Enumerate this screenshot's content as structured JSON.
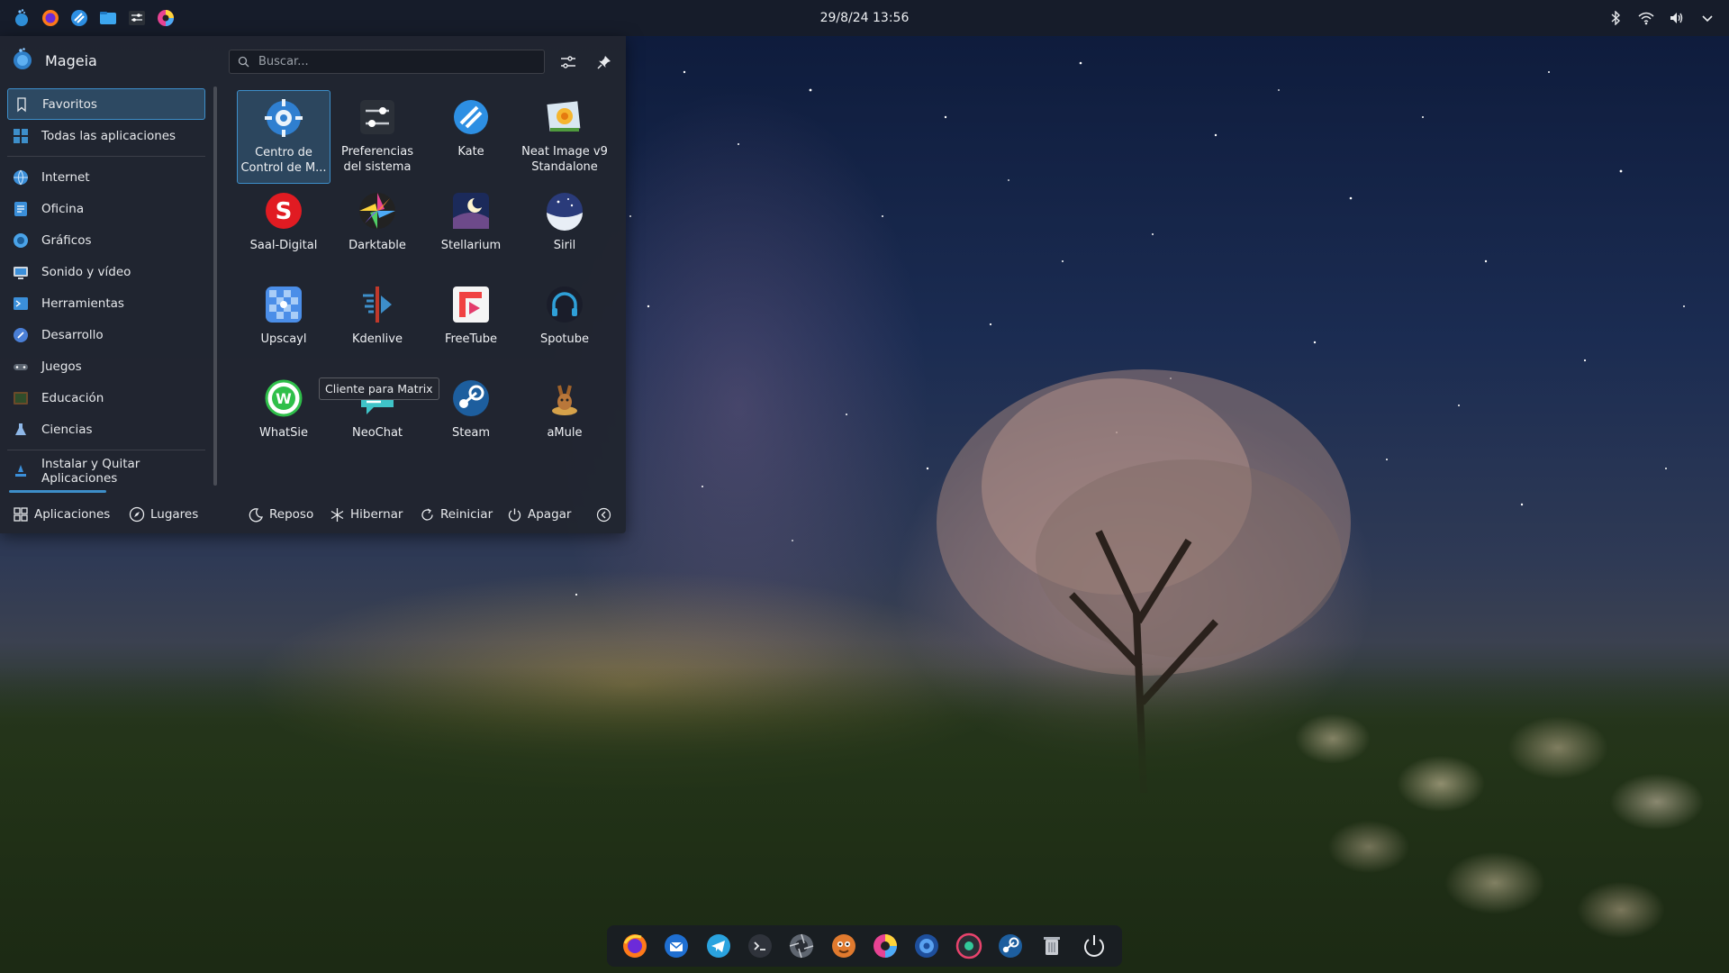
{
  "top_panel": {
    "clock": "29/8/24 13:56",
    "left_icons": [
      "mageia-menu-icon",
      "firefox-icon",
      "kate-icon",
      "file-manager-icon",
      "system-settings-icon",
      "color-wheel-icon"
    ],
    "tray_icons": [
      "bluetooth-icon",
      "wifi-icon",
      "volume-icon",
      "chevron-down-icon"
    ]
  },
  "launcher": {
    "user": "Mageia",
    "search": {
      "placeholder": "Buscar...",
      "value": ""
    },
    "categories": [
      {
        "label": "Favoritos",
        "icon": "bookmark-icon",
        "active": true
      },
      {
        "label": "Todas las aplicaciones",
        "icon": "grid-icon",
        "active": false
      },
      {
        "label": "Internet",
        "icon": "internet-icon",
        "active": false
      },
      {
        "label": "Oficina",
        "icon": "office-icon",
        "active": false
      },
      {
        "label": "Gráficos",
        "icon": "graphics-icon",
        "active": false
      },
      {
        "label": "Sonido y vídeo",
        "icon": "multimedia-icon",
        "active": false
      },
      {
        "label": "Herramientas",
        "icon": "tools-icon",
        "active": false
      },
      {
        "label": "Desarrollo",
        "icon": "development-icon",
        "active": false
      },
      {
        "label": "Juegos",
        "icon": "games-icon",
        "active": false
      },
      {
        "label": "Educación",
        "icon": "education-icon",
        "active": false
      },
      {
        "label": "Ciencias",
        "icon": "science-icon",
        "active": false
      },
      {
        "label": "Instalar y Quitar Aplicaciones",
        "icon": "install-icon",
        "active": false
      }
    ],
    "apps": [
      {
        "label": "Centro de Control de M...",
        "icon": "control-center-icon",
        "selected": true
      },
      {
        "label": "Preferencias del sistema",
        "icon": "system-preferences-icon",
        "selected": false
      },
      {
        "label": "Kate",
        "icon": "kate-icon",
        "selected": false
      },
      {
        "label": "Neat Image v9 Standalone",
        "icon": "neat-image-icon",
        "selected": false
      },
      {
        "label": "Saal-Digital",
        "icon": "saal-digital-icon",
        "selected": false
      },
      {
        "label": "Darktable",
        "icon": "darktable-icon",
        "selected": false
      },
      {
        "label": "Stellarium",
        "icon": "stellarium-icon",
        "selected": false
      },
      {
        "label": "Siril",
        "icon": "siril-icon",
        "selected": false
      },
      {
        "label": "Upscayl",
        "icon": "upscayl-icon",
        "selected": false
      },
      {
        "label": "Kdenlive",
        "icon": "kdenlive-icon",
        "selected": false
      },
      {
        "label": "FreeTube",
        "icon": "freetube-icon",
        "selected": false
      },
      {
        "label": "Spotube",
        "icon": "spotube-icon",
        "selected": false
      },
      {
        "label": "WhatSie",
        "icon": "whatsie-icon",
        "selected": false
      },
      {
        "label": "NeoChat",
        "icon": "neochat-icon",
        "selected": false
      },
      {
        "label": "Steam",
        "icon": "steam-icon",
        "selected": false
      },
      {
        "label": "aMule",
        "icon": "amule-icon",
        "selected": false
      }
    ],
    "tooltip": "Cliente para Matrix",
    "bottom_tabs": {
      "apps": "Aplicaciones",
      "places": "Lugares"
    },
    "power": {
      "sleep": "Reposo",
      "hibernate": "Hibernar",
      "restart": "Reiniciar",
      "shutdown": "Apagar"
    }
  },
  "dock_icons": [
    "firefox-icon",
    "thunderbird-icon",
    "telegram-icon",
    "terminal-icon",
    "aperture-icon",
    "gimp-icon",
    "color-wheel-icon",
    "browser-icon",
    "record-icon",
    "steam-icon",
    "trash-icon",
    "power-icon"
  ]
}
